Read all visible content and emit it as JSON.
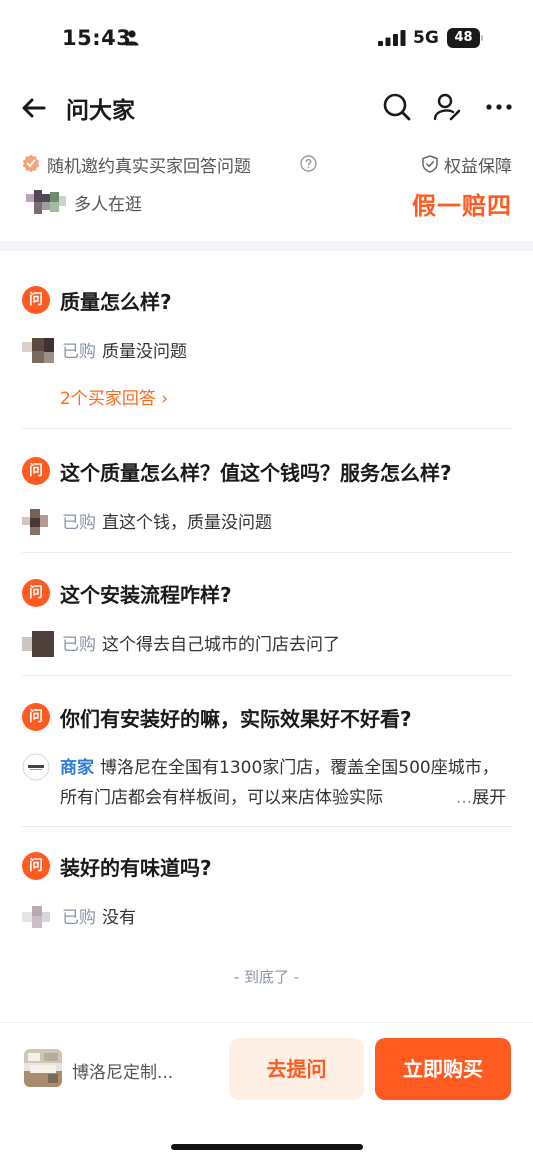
{
  "status_bar": {
    "time": "15:43",
    "network": "5G",
    "battery": "48",
    "battery_level_percent": 48
  },
  "nav": {
    "title": "问大家"
  },
  "header": {
    "invite_text": "随机邀约真实买家回答问题",
    "rights_label": "权益保障",
    "browsing_text": "多人在逛",
    "promise_label": "假一赔四"
  },
  "questions": [
    {
      "question": "质量怎么样?",
      "answer_tag": "已购",
      "answer": "质量没问题",
      "more_answers": "2个买家回答 ›"
    },
    {
      "question": "这个质量怎么样？值这个钱吗？服务怎么样?",
      "answer_tag": "已购",
      "answer": "直这个钱，质量没问题"
    },
    {
      "question": "这个安装流程咋样?",
      "answer_tag": "已购",
      "answer": "这个得去自己城市的门店去问了"
    },
    {
      "question": "你们有安装好的嘛，实际效果好不好看?",
      "answer_tag": "商家",
      "answer": "博洛尼在全国有1300家门店，覆盖全国500座城市，所有门店都会有样板间，可以来店体验实际",
      "expand_dots": "...",
      "expand_label": "展开"
    },
    {
      "question": "装好的有味道吗?",
      "answer_tag": "已购",
      "answer": "没有"
    }
  ],
  "question_badge": "问",
  "end_text": "- 到底了 -",
  "bottom_bar": {
    "product_name": "博洛尼定制...",
    "ask_button": "去提问",
    "buy_button": "立即购买"
  },
  "colors": {
    "accent": "#ff5a1f",
    "merchant": "#2f7bd8",
    "muted": "#8a94a6"
  },
  "icons": [
    "person-icon",
    "signal-icon",
    "back-arrow-icon",
    "search-icon",
    "user-edit-icon",
    "more-icon",
    "badge-icon",
    "help-icon",
    "shield-icon"
  ]
}
